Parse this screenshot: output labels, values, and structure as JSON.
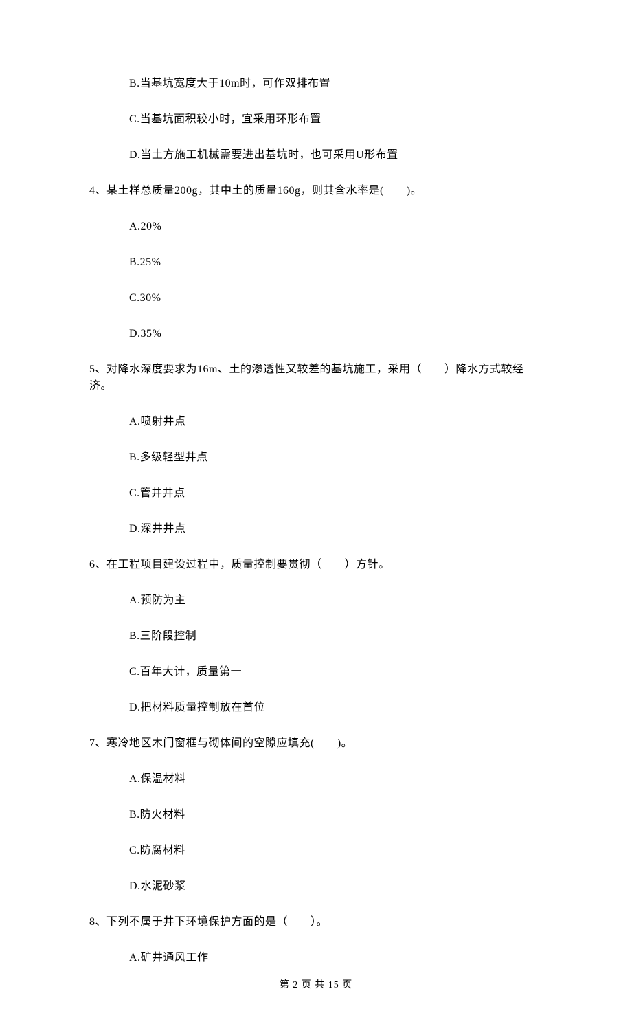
{
  "options_pre": [
    "B.当基坑宽度大于10m时，可作双排布置",
    "C.当基坑面积较小时，宜采用环形布置",
    "D.当土方施工机械需要进出基坑时，也可采用U形布置"
  ],
  "questions": [
    {
      "stem": "4、某土样总质量200g，其中土的质量160g，则其含水率是(　　)。",
      "options": [
        "A.20%",
        "B.25%",
        "C.30%",
        "D.35%"
      ]
    },
    {
      "stem": "5、对降水深度要求为16m、土的渗透性又较差的基坑施工，采用（　　）降水方式较经济。",
      "options": [
        "A.喷射井点",
        "B.多级轻型井点",
        "C.管井井点",
        "D.深井井点"
      ]
    },
    {
      "stem": "6、在工程项目建设过程中，质量控制要贯彻（　　）方针。",
      "options": [
        "A.预防为主",
        "B.三阶段控制",
        "C.百年大计，质量第一",
        "D.把材料质量控制放在首位"
      ]
    },
    {
      "stem": "7、寒冷地区木门窗框与砌体间的空隙应填充(　　)。",
      "options": [
        "A.保温材料",
        "B.防火材料",
        "C.防腐材料",
        "D.水泥砂浆"
      ]
    },
    {
      "stem": "8、下列不属于井下环境保护方面的是（　　）。",
      "options": [
        "A.矿井通风工作"
      ]
    }
  ],
  "footer": "第 2 页 共 15 页"
}
